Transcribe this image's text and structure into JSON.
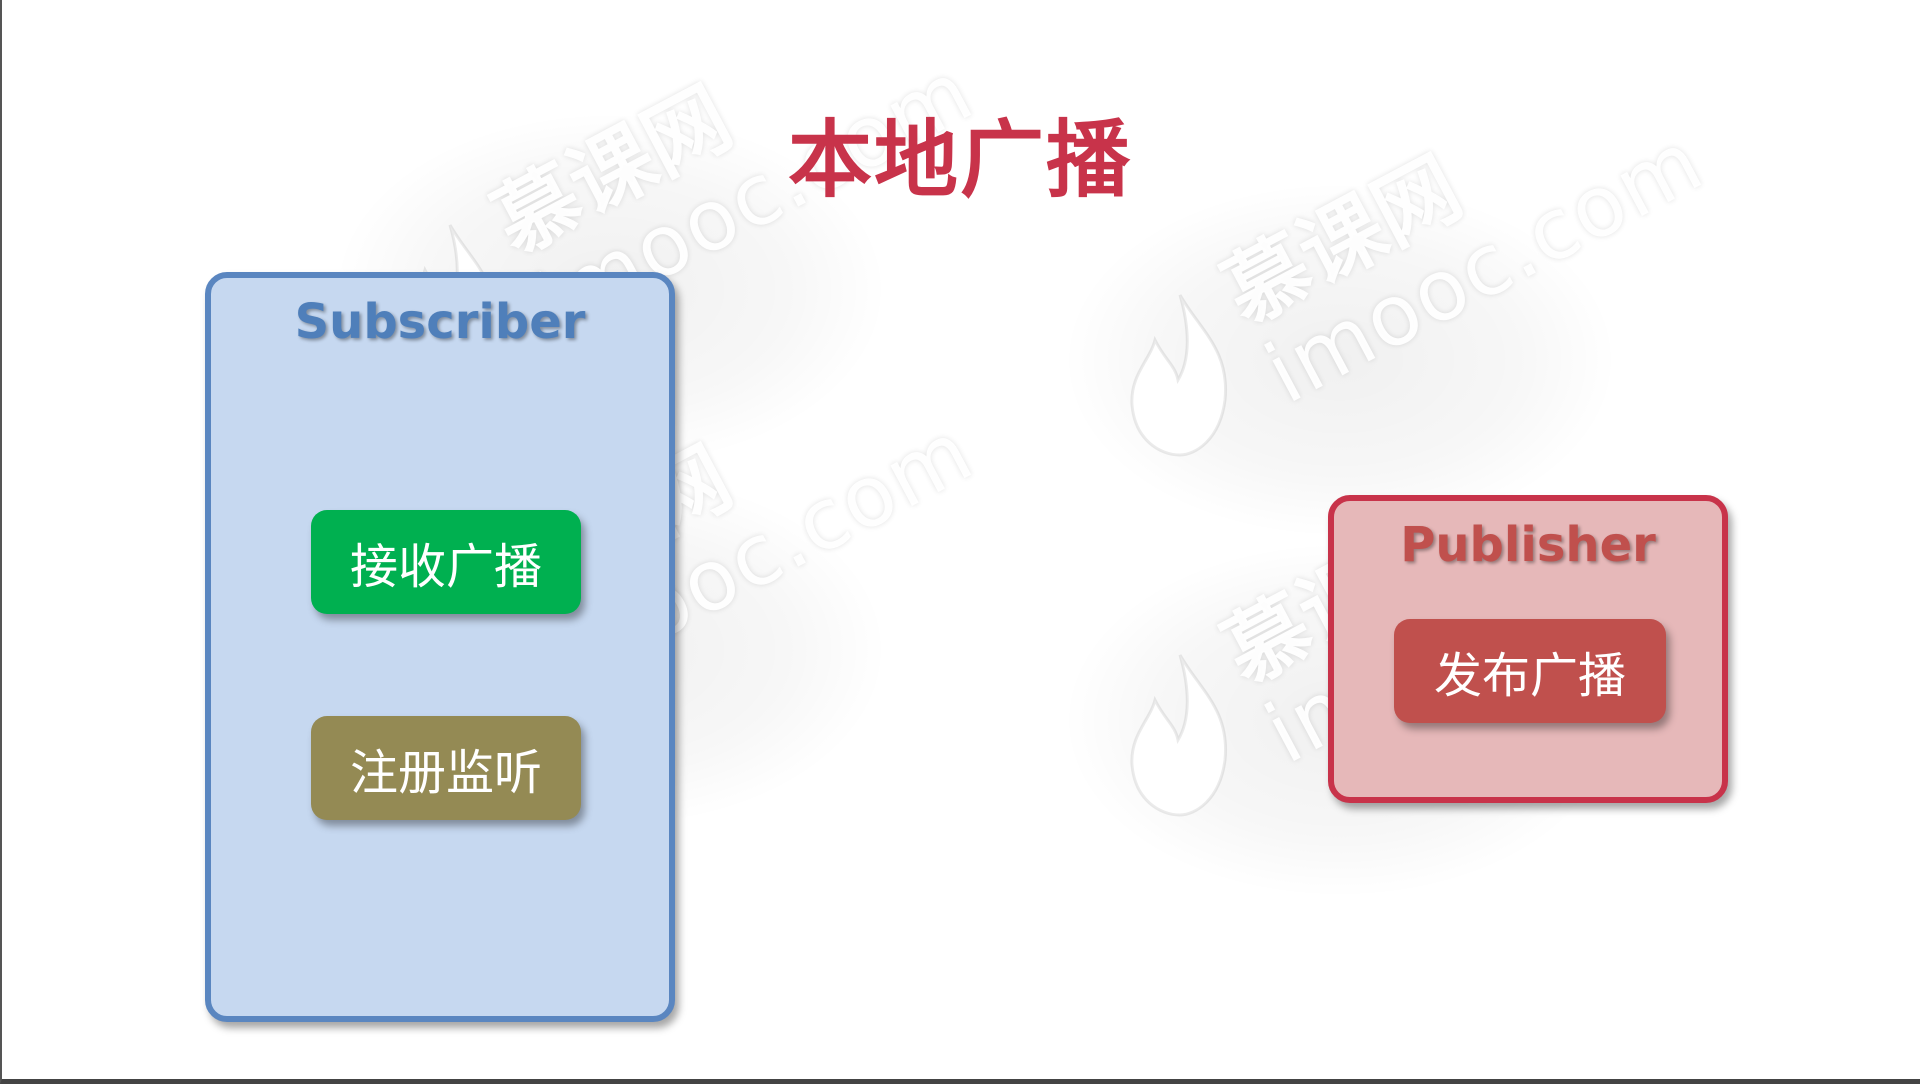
{
  "title": "本地广播",
  "subscriber": {
    "title": "Subscriber",
    "actions": [
      "接收广播",
      "注册监听"
    ]
  },
  "publisher": {
    "title": "Publisher",
    "actions": [
      "发布广播"
    ]
  },
  "watermark": {
    "brand": "慕课网",
    "domain": "imooc.com"
  },
  "colors": {
    "title": "#c8334a",
    "subscriber_fill": "#c6d8f0",
    "subscriber_border": "#5a86c0",
    "publisher_fill": "#e6b8b9",
    "publisher_border": "#c8334a",
    "receive_button": "#00b050",
    "register_button": "#948a54",
    "publish_button": "#c0504d"
  }
}
